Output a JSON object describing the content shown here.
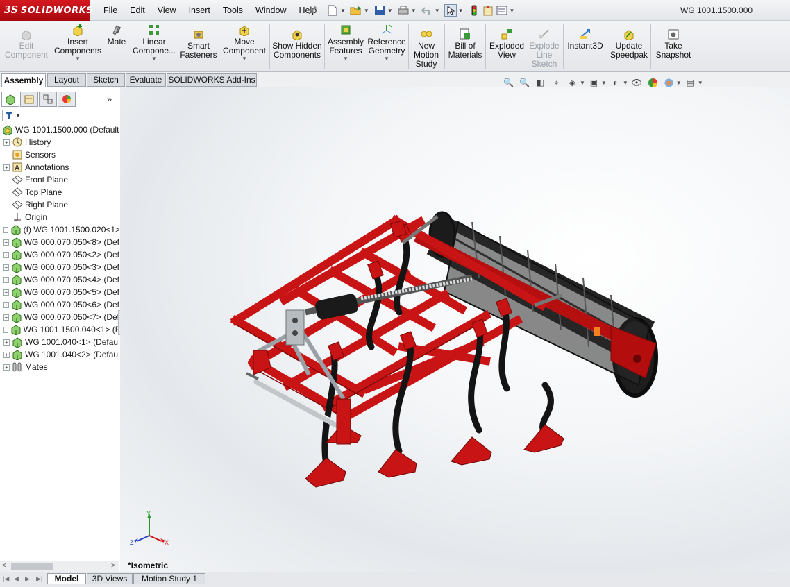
{
  "app": {
    "logo_ds": "3S",
    "logo_text": "SOLIDWORKS",
    "document_title": "WG 1001.1500.000"
  },
  "menu": [
    "File",
    "Edit",
    "View",
    "Insert",
    "Tools",
    "Window",
    "Help"
  ],
  "quick_access_icons": [
    "new-icon",
    "open-icon",
    "save-icon",
    "print-icon",
    "undo-icon",
    "select-icon",
    "rebuild-icon",
    "file-properties-icon",
    "options-icon"
  ],
  "commands": {
    "edit_component": "Edit Component",
    "insert_components": "Insert Components",
    "mate": "Mate",
    "linear_component": "Linear Compone...",
    "smart_fasteners": "Smart Fasteners",
    "move_component": "Move Component",
    "show_hidden": "Show Hidden Components",
    "assembly_features": "Assembly Features",
    "reference_geometry": "Reference Geometry",
    "new_motion_study": "New Motion Study",
    "bill_of_materials": "Bill of Materials",
    "exploded_view": "Exploded View",
    "explode_line_sketch": "Explode Line Sketch",
    "instant3d": "Instant3D",
    "update_speedpak": "Update Speedpak",
    "take_snapshot": "Take Snapshot"
  },
  "tabs": [
    "Assembly",
    "Layout",
    "Sketch",
    "Evaluate",
    "SOLIDWORKS Add-Ins"
  ],
  "feature_tree": {
    "root": "WG 1001.1500.000  (Default<",
    "items": [
      {
        "label": "History",
        "icon": "history-icon",
        "expandable": true
      },
      {
        "label": "Sensors",
        "icon": "sensors-icon",
        "expandable": false
      },
      {
        "label": "Annotations",
        "icon": "annotations-icon",
        "expandable": true
      },
      {
        "label": "Front Plane",
        "icon": "plane-icon",
        "expandable": false
      },
      {
        "label": "Top Plane",
        "icon": "plane-icon",
        "expandable": false
      },
      {
        "label": "Right Plane",
        "icon": "plane-icon",
        "expandable": false
      },
      {
        "label": "Origin",
        "icon": "origin-icon",
        "expandable": false
      },
      {
        "label": "(f) WG 1001.1500.020<1>",
        "icon": "part-icon",
        "expandable": true
      },
      {
        "label": "WG 000.070.050<8> (Def",
        "icon": "part-icon",
        "expandable": true
      },
      {
        "label": "WG 000.070.050<2> (Def",
        "icon": "part-icon",
        "expandable": true
      },
      {
        "label": "WG 000.070.050<3> (Def",
        "icon": "part-icon",
        "expandable": true
      },
      {
        "label": "WG 000.070.050<4> (Def",
        "icon": "part-icon",
        "expandable": true
      },
      {
        "label": "WG 000.070.050<5> (Def",
        "icon": "part-icon",
        "expandable": true
      },
      {
        "label": "WG 000.070.050<6> (Def",
        "icon": "part-icon",
        "expandable": true
      },
      {
        "label": "WG 000.070.050<7> (Def",
        "icon": "part-icon",
        "expandable": true
      },
      {
        "label": "WG 1001.1500.040<1> (F",
        "icon": "part-icon",
        "expandable": true
      },
      {
        "label": "WG 1001.040<1> (Defau",
        "icon": "part-icon",
        "expandable": true
      },
      {
        "label": "WG 1001.040<2> (Defau",
        "icon": "part-icon",
        "expandable": true
      },
      {
        "label": "Mates",
        "icon": "mates-icon",
        "expandable": true
      }
    ]
  },
  "viewport": {
    "view_label": "*Isometric",
    "triad": {
      "x": "X",
      "y": "Y",
      "z": "Z"
    }
  },
  "bottom_tabs": [
    "Model",
    "3D Views",
    "Motion Study 1"
  ],
  "colors": {
    "model_red": "#c81414",
    "accent_red": "#c00",
    "frame_dark": "#1e1e1e"
  }
}
